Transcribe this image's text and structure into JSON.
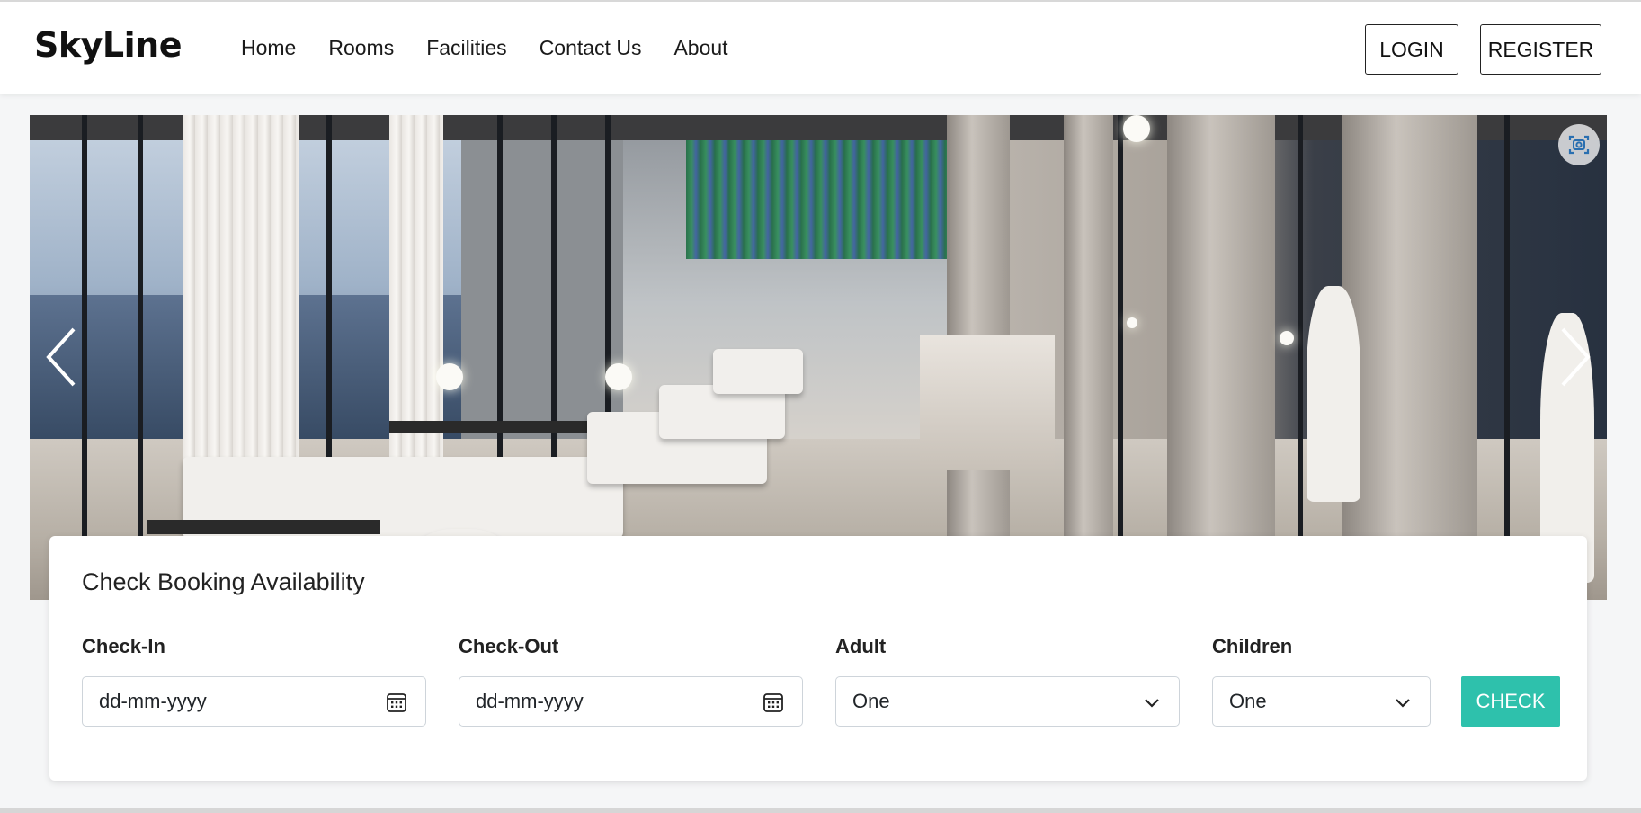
{
  "brand": "SkyLine",
  "nav": {
    "links": [
      "Home",
      "Rooms",
      "Facilities",
      "Contact Us",
      "About"
    ],
    "login_label": "LOGIN",
    "register_label": "REGISTER"
  },
  "carousel": {
    "prev_icon": "chevron-left-icon",
    "next_icon": "chevron-right-icon",
    "screenshot_icon": "camera-capture-icon"
  },
  "booking": {
    "title": "Check Booking Availability",
    "checkin": {
      "label": "Check-In",
      "placeholder": "dd-mm-yyyy"
    },
    "checkout": {
      "label": "Check-Out",
      "placeholder": "dd-mm-yyyy"
    },
    "adult": {
      "label": "Adult",
      "value": "One"
    },
    "children": {
      "label": "Children",
      "value": "One"
    },
    "check_label": "CHECK"
  },
  "colors": {
    "accent": "#2ec1ac",
    "text": "#212529",
    "border": "#ced4da"
  }
}
